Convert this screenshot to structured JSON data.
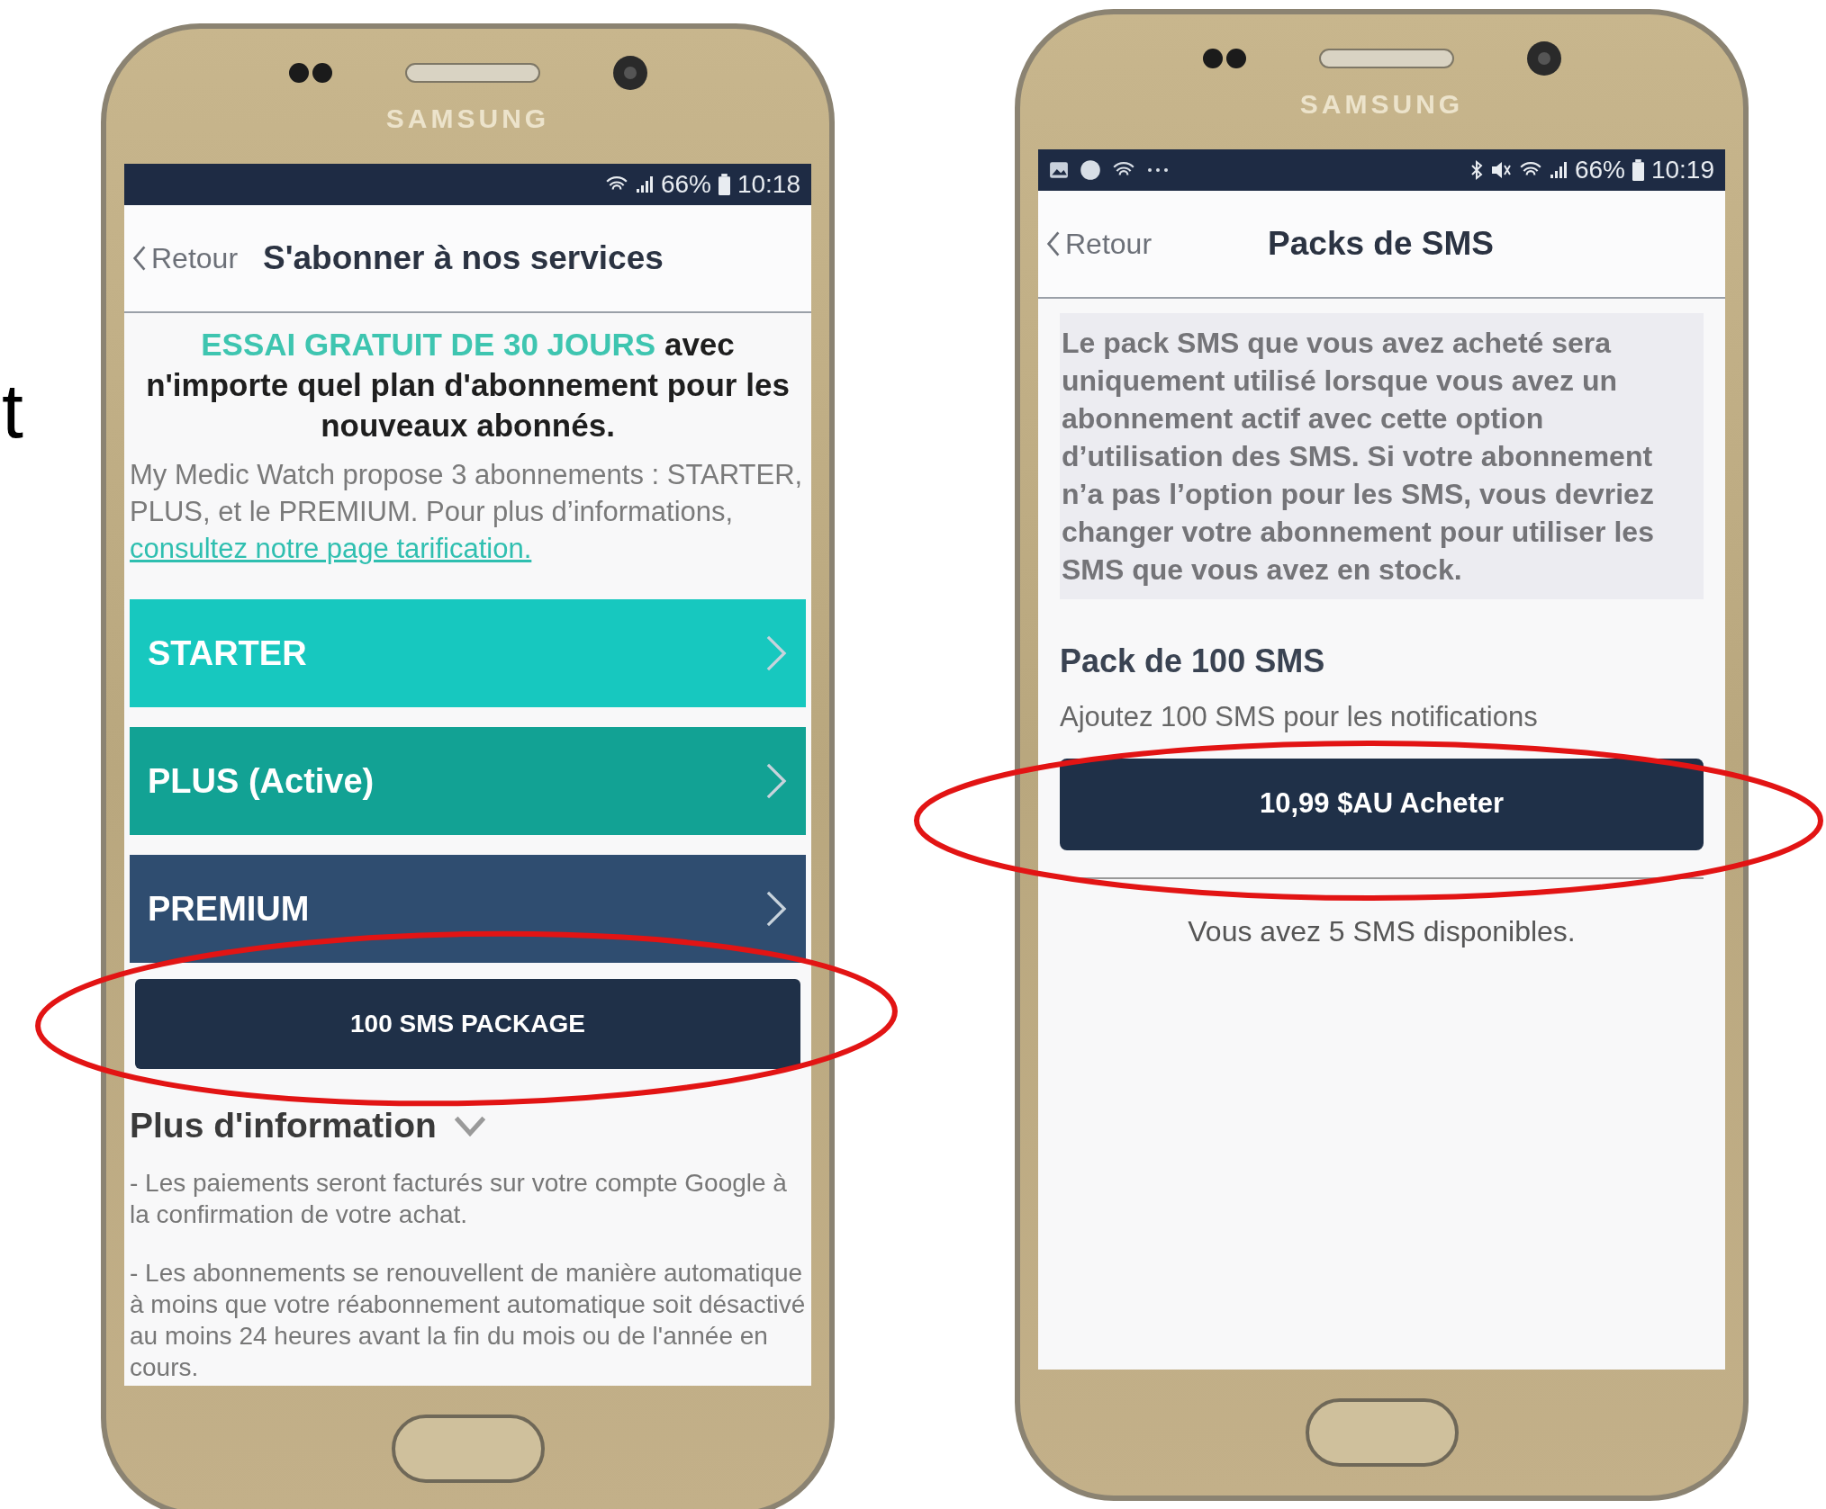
{
  "edge_text": "t",
  "phones": [
    {
      "brand": "SAMSUNG",
      "status_bar": {
        "battery": "66%",
        "time": "10:18"
      },
      "header": {
        "back": "Retour",
        "title": "S'abonner à nos services"
      },
      "kind": "subscriptions",
      "promo": {
        "highlight": "ESSAI GRATUIT DE 30 JOURS",
        "rest": "avec n'importe quel plan d'abonnement pour les nouveaux abonnés."
      },
      "description": "My Medic Watch propose 3 abonnements : STARTER, PLUS, et le PREMIUM. Pour plus d’informations,",
      "description_link": "consultez notre page tarification.",
      "plans": [
        {
          "label": "STARTER",
          "color": "#17c8bf"
        },
        {
          "label": "PLUS (Active)",
          "color": "#12a294"
        },
        {
          "label": "PREMIUM",
          "color": "#2f4d70"
        }
      ],
      "sms_button": "100 SMS PACKAGE",
      "more_info": {
        "title": "Plus d'information",
        "expanded": true,
        "paragraphs": [
          "- Les paiements seront facturés sur votre compte Google à la confirmation de votre achat.",
          "- Les abonnements se renouvellent de manière automatique à moins que votre réabonnement automatique soit désactivé au moins 24 heures avant la fin du mois ou de l'année en cours."
        ]
      }
    },
    {
      "brand": "SAMSUNG",
      "status_bar": {
        "battery": "66%",
        "time": "10:19"
      },
      "header": {
        "back": "Retour",
        "title": "Packs de SMS"
      },
      "kind": "sms_packs",
      "notice": "Le pack SMS que vous avez acheté sera uniquement utilisé lorsque vous avez un abonnement actif avec cette option d’utilisation des SMS. Si votre abonnement n’a pas l’option pour les SMS, vous devriez changer votre abonnement pour utiliser les SMS que vous avez en stock.",
      "pack": {
        "title": "Pack de 100 SMS",
        "subtitle": "Ajoutez 100 SMS pour les notifications",
        "buy_button": "10,99 $AU Acheter"
      },
      "balance": "Vous avez 5 SMS disponibles."
    }
  ]
}
